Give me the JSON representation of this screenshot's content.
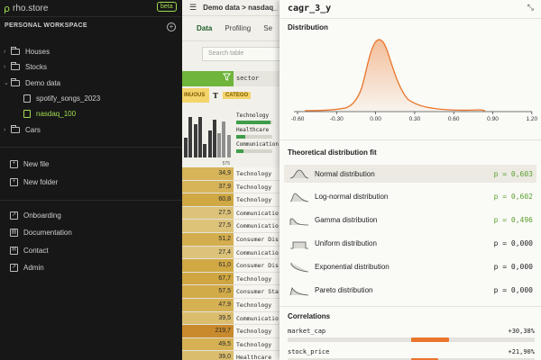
{
  "app": {
    "name": "rho.store",
    "badge": "beta",
    "logo_glyph": "ρ"
  },
  "sidebar": {
    "workspace_label": "PERSONAL WORKSPACE",
    "add_glyph": "+",
    "tree": [
      {
        "label": "Houses",
        "type": "folder",
        "level": 0
      },
      {
        "label": "Stocks",
        "type": "folder",
        "level": 0
      },
      {
        "label": "Demo data",
        "type": "folder",
        "level": 0,
        "expanded": true
      },
      {
        "label": "spotify_songs_2023",
        "type": "table",
        "level": 1
      },
      {
        "label": "nasdaq_100",
        "type": "table",
        "level": 1,
        "active": true
      },
      {
        "label": "Cars",
        "type": "folder",
        "level": 0
      }
    ],
    "actions": [
      {
        "label": "New file",
        "icon": "new-file-icon"
      },
      {
        "label": "New folder",
        "icon": "new-folder-icon"
      }
    ],
    "links": [
      {
        "label": "Onboarding",
        "icon": "onboarding-icon"
      },
      {
        "label": "Documentation",
        "icon": "documentation-icon"
      },
      {
        "label": "Contact",
        "icon": "contact-icon"
      },
      {
        "label": "Admin",
        "icon": "admin-icon"
      }
    ]
  },
  "middle": {
    "breadcrumb": "Demo data  >  nasdaq_",
    "tabs": [
      "Data",
      "Profiling",
      "Se"
    ],
    "active_tab": "Data",
    "search_placeholder": "Search table",
    "column_label": "sector",
    "type_a": "INUOUS",
    "type_b_glyph": "T",
    "type_b": "CATEGO",
    "hist_count": "575",
    "hist_heights": [
      0.45,
      0.9,
      0.75,
      0.9,
      0.3,
      0.6,
      0.85,
      0.55,
      0.8,
      0.5
    ],
    "categories": [
      {
        "label": "Technology",
        "share": 0.95
      },
      {
        "label": "Healthcare",
        "share": 0.25
      },
      {
        "label": "Communication",
        "share": 0.2
      }
    ],
    "rows": [
      {
        "value": "34,9",
        "sector": "Technology"
      },
      {
        "value": "37,9",
        "sector": "Technology"
      },
      {
        "value": "60,8",
        "sector": "Technology"
      },
      {
        "value": "27,5",
        "sector": "Communicatio"
      },
      {
        "value": "27,5",
        "sector": "Communicatio"
      },
      {
        "value": "51,2",
        "sector": "Consumer Dis"
      },
      {
        "value": "27,4",
        "sector": "Communicatio"
      },
      {
        "value": "61,0",
        "sector": "Consumer Dis"
      },
      {
        "value": "67,7",
        "sector": "Technology"
      },
      {
        "value": "57,5",
        "sector": "Consumer Sta"
      },
      {
        "value": "47,9",
        "sector": "Technology"
      },
      {
        "value": "39,5",
        "sector": "Communicatio"
      },
      {
        "value": "219,7",
        "sector": "Technology"
      },
      {
        "value": "49,5",
        "sector": "Technology"
      },
      {
        "value": "39,0",
        "sector": "Healthcare"
      }
    ],
    "row_colors": [
      "#d7b45a",
      "#d7b45a",
      "#d0a844",
      "#ddc37a",
      "#ddc37a",
      "#d4ae4e",
      "#ddc37a",
      "#d0a844",
      "#cfa640",
      "#d2ab49",
      "#d5b153",
      "#dbbd6e",
      "#c98a2e",
      "#d5b153",
      "#dbbd6e"
    ]
  },
  "panel": {
    "column_name": "cagr_3_y",
    "collapse_glyph": "⤡",
    "distribution_title": "Distribution",
    "axis_ticks": [
      "-0.60",
      "-0.30",
      "0.00",
      "0.30",
      "0.60",
      "0.90",
      "1.20"
    ],
    "fit_title": "Theoretical distribution fit",
    "fits": [
      {
        "name": "Normal distribution",
        "p": "p = 0,603",
        "good": true,
        "selected": true,
        "icon": "normal-curve-icon"
      },
      {
        "name": "Log-normal distribution",
        "p": "p = 0,602",
        "good": true,
        "icon": "lognormal-curve-icon"
      },
      {
        "name": "Gamma distribution",
        "p": "p = 0,496",
        "good": true,
        "icon": "gamma-curve-icon"
      },
      {
        "name": "Uniform distribution",
        "p": "p = 0,000",
        "good": false,
        "icon": "uniform-curve-icon"
      },
      {
        "name": "Exponential distribution",
        "p": "p = 0,000",
        "good": false,
        "icon": "exponential-curve-icon"
      },
      {
        "name": "Pareto distribution",
        "p": "p = 0,000",
        "good": false,
        "icon": "pareto-curve-icon"
      }
    ],
    "correlations_title": "Correlations",
    "correlations": [
      {
        "name": "market_cap",
        "value": "+30,38%",
        "r": 0.3038
      },
      {
        "name": "stock_price",
        "value": "+21,90%",
        "r": 0.219
      }
    ],
    "accent": "#e9762a",
    "good_color": "#5aa02c"
  }
}
